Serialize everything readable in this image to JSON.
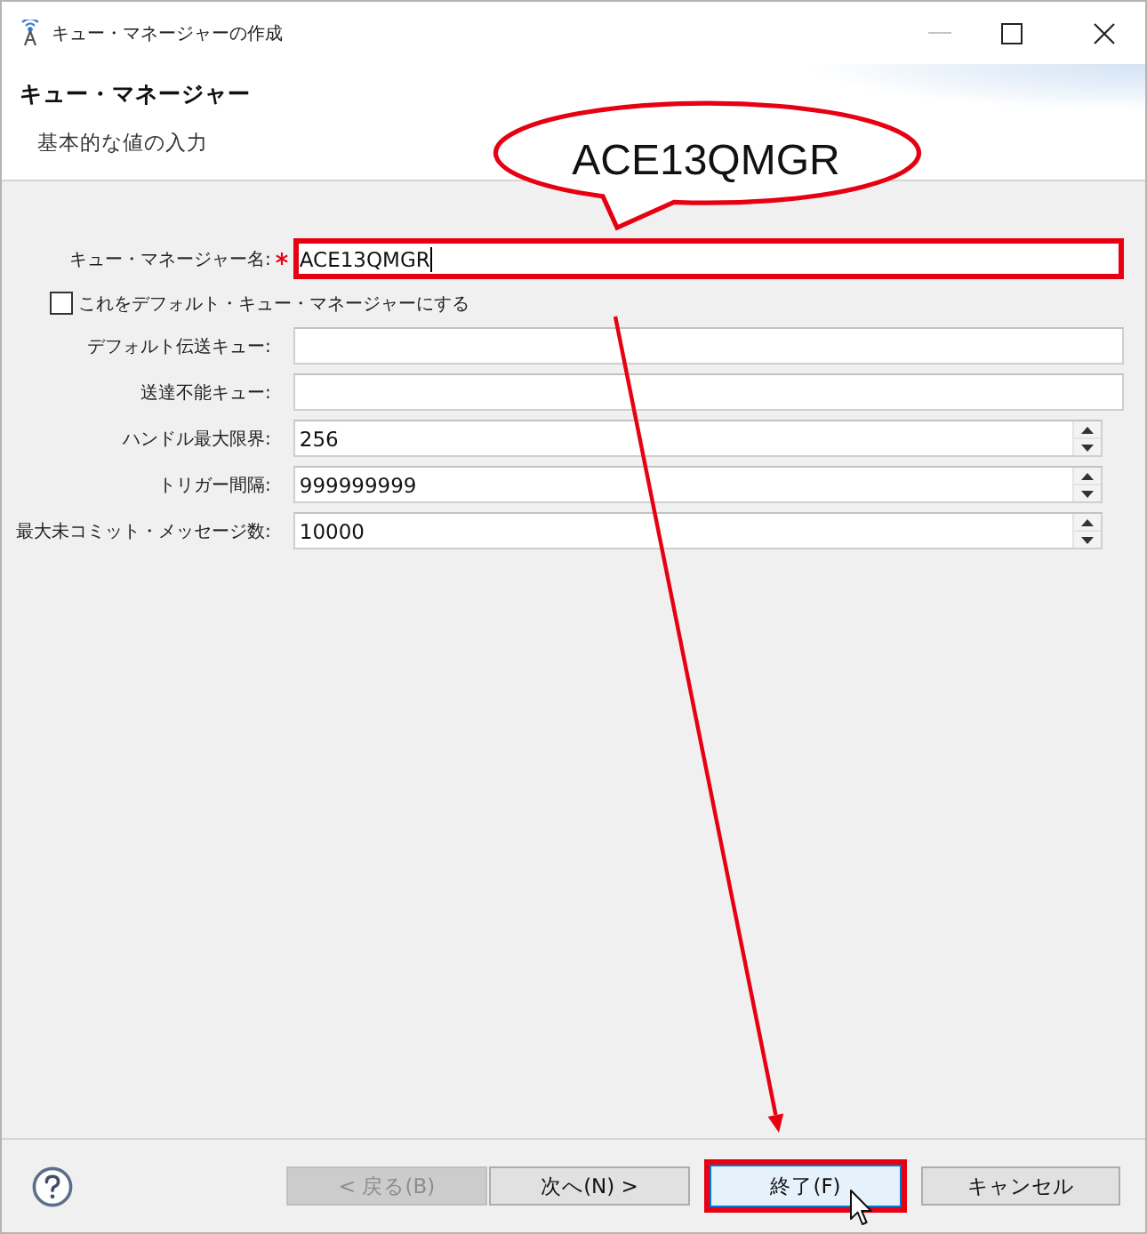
{
  "window": {
    "title": "キュー・マネージャーの作成",
    "controls": [
      {
        "kind": "minimize",
        "disabled": true
      },
      {
        "kind": "maximize",
        "disabled": false
      },
      {
        "kind": "close",
        "disabled": false
      }
    ]
  },
  "header": {
    "title": "キュー・マネージャー",
    "description": "基本的な値の入力"
  },
  "form": {
    "rows": [
      {
        "kind": "text",
        "label": "キュー・マネージャー名:",
        "required": true,
        "value": "ACE13QMGR",
        "focused": true,
        "highlighted": true
      },
      {
        "kind": "checkbox",
        "label": "これをデフォルト・キュー・マネージャーにする",
        "checked": false
      },
      {
        "kind": "text",
        "label": "デフォルト伝送キュー:",
        "required": false,
        "focused": false,
        "highlighted": false
      },
      {
        "kind": "text",
        "label": "送達不能キュー:",
        "required": false,
        "focused": false,
        "highlighted": false
      },
      {
        "kind": "spinner",
        "label": "ハンドル最大限界:",
        "required": false,
        "value": "256",
        "focused": false,
        "highlighted": false
      },
      {
        "kind": "spinner",
        "label": "トリガー間隔:",
        "required": false,
        "value": "999999999",
        "focused": false,
        "highlighted": false
      },
      {
        "kind": "spinner",
        "label": "最大未コミット・メッセージ数:",
        "required": false,
        "value": "10000",
        "focused": false,
        "highlighted": false
      }
    ]
  },
  "callout": {
    "text": "ACE13QMGR"
  },
  "buttons": [
    {
      "label": "< 戻る(B)",
      "disabled": true,
      "default": false,
      "highlighted": false
    },
    {
      "label": "次へ(N) >",
      "disabled": false,
      "default": false,
      "highlighted": false
    },
    {
      "label": "終了(F)",
      "disabled": false,
      "default": true,
      "highlighted": true
    },
    {
      "label": "キャンセル",
      "disabled": false,
      "default": false,
      "highlighted": false
    }
  ]
}
